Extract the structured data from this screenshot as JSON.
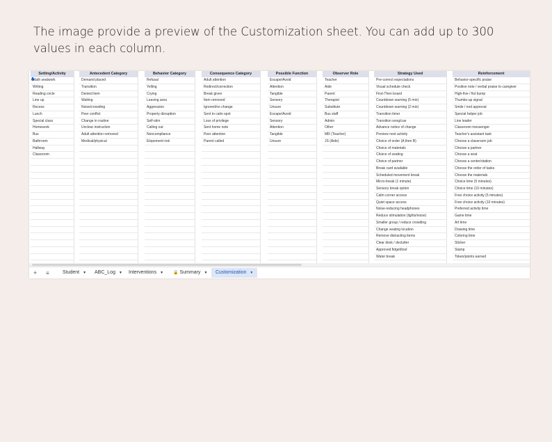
{
  "caption": "The image provide a preview of the Customization sheet. You can add up to 300 values in each column.",
  "columns": [
    {
      "header": "Setting/Activity",
      "values": [
        "Math seatwork",
        "Writing",
        "Reading circle",
        "Line up",
        "Recess",
        "Lunch",
        "Special class",
        "Homework",
        "Bus",
        "Bathroom",
        "Hallway",
        "Classroom"
      ]
    },
    {
      "header": "Antecedent Category",
      "values": [
        "Demand placed",
        "Transition",
        "Denied item",
        "Waiting",
        "Noise/crowding",
        "Peer conflict",
        "Change in routine",
        "Unclear instruction",
        "Adult attention removed",
        "Medical/physical"
      ]
    },
    {
      "header": "Behavior Category",
      "values": [
        "Refusal",
        "Yelling",
        "Crying",
        "Leaving area",
        "Aggression",
        "Property disruption",
        "Self-stim",
        "Calling out",
        "Noncompliance",
        "Elopement risk"
      ]
    },
    {
      "header": "Consequence Category",
      "values": [
        "Adult attention",
        "Redirect/correction",
        "Break given",
        "Item removed",
        "Ignored/no change",
        "Sent to calm spot",
        "Loss of privilege",
        "Sent home note",
        "Peer attention",
        "Parent called"
      ]
    },
    {
      "header": "Possible Function",
      "values": [
        "Escape/Avoid",
        "Attention",
        "Tangible",
        "Sensory",
        "Unsure",
        "Escape/Avoid",
        "Sensory",
        "Attention",
        "Tangible",
        "Unsure"
      ]
    },
    {
      "header": "Observer Role",
      "values": [
        "Teacher",
        "Aide",
        "Parent",
        "Therapist",
        "Substitute",
        "Bus staff",
        "Admin",
        "Other",
        "MR (Teacher)",
        "JS (Aide)"
      ]
    },
    {
      "header": "Strategy Used",
      "values": [
        "Pre-correct expectations",
        "Visual schedule check",
        "First-Then board",
        "Countdown warning (5 min)",
        "Countdown warning (2 min)",
        "Transition timer",
        "Transition song/cue",
        "Advance notice of change",
        "Preview next activity",
        "Choice of order (A then B)",
        "Choice of materials",
        "Choice of seating",
        "Choice of partner",
        "Break card available",
        "Scheduled movement break",
        "Micro-break (1 minute)",
        "Sensory break option",
        "Calm corner access",
        "Quiet space access",
        "Noise-reducing headphones",
        "Reduce stimulation (lights/noise)",
        "Smaller group / reduce crowding",
        "Change seating location",
        "Remove distracting items",
        "Clear desk / declutter",
        "Approved fidget/tool",
        "Water break"
      ]
    },
    {
      "header": "Reinforcement",
      "values": [
        "Behavior-specific praise",
        "Positive note / verbal praise to caregiver",
        "High-five / fist bump",
        "Thumbs-up signal",
        "Smile / nod approval",
        "Special helper job",
        "Line leader",
        "Classroom messenger",
        "Teacher's assistant task",
        "Choose a classroom job",
        "Choose a partner",
        "Choose a seat",
        "Choose a center/station",
        "Choose the order of tasks",
        "Choose the materials",
        "Choice time (5 minutes)",
        "Choice time (10 minutes)",
        "Free choice activity (5 minutes)",
        "Free choice activity (10 minutes)",
        "Preferred activity time",
        "Game time",
        "Art time",
        "Drawing time",
        "Coloring time",
        "Sticker",
        "Stamp",
        "Token/points earned"
      ]
    }
  ],
  "tabs": [
    {
      "label": "Student",
      "active": false,
      "locked": false
    },
    {
      "label": "ABC_Log",
      "active": false,
      "locked": false
    },
    {
      "label": "Interventions",
      "active": false,
      "locked": false
    },
    {
      "label": "Summary",
      "active": false,
      "locked": true
    },
    {
      "label": "Customization",
      "active": true,
      "locked": false
    }
  ],
  "tab_icons": {
    "add": "plus-icon",
    "all_sheets": "menu-icon",
    "lock": "lock-icon",
    "dropdown": "caret-down-icon"
  },
  "colors": {
    "header_bg": "#dde0ea",
    "active_tab_bg": "#dde6f6",
    "active_tab_text": "#1a53b5",
    "page_bg": "#f5ede9"
  }
}
